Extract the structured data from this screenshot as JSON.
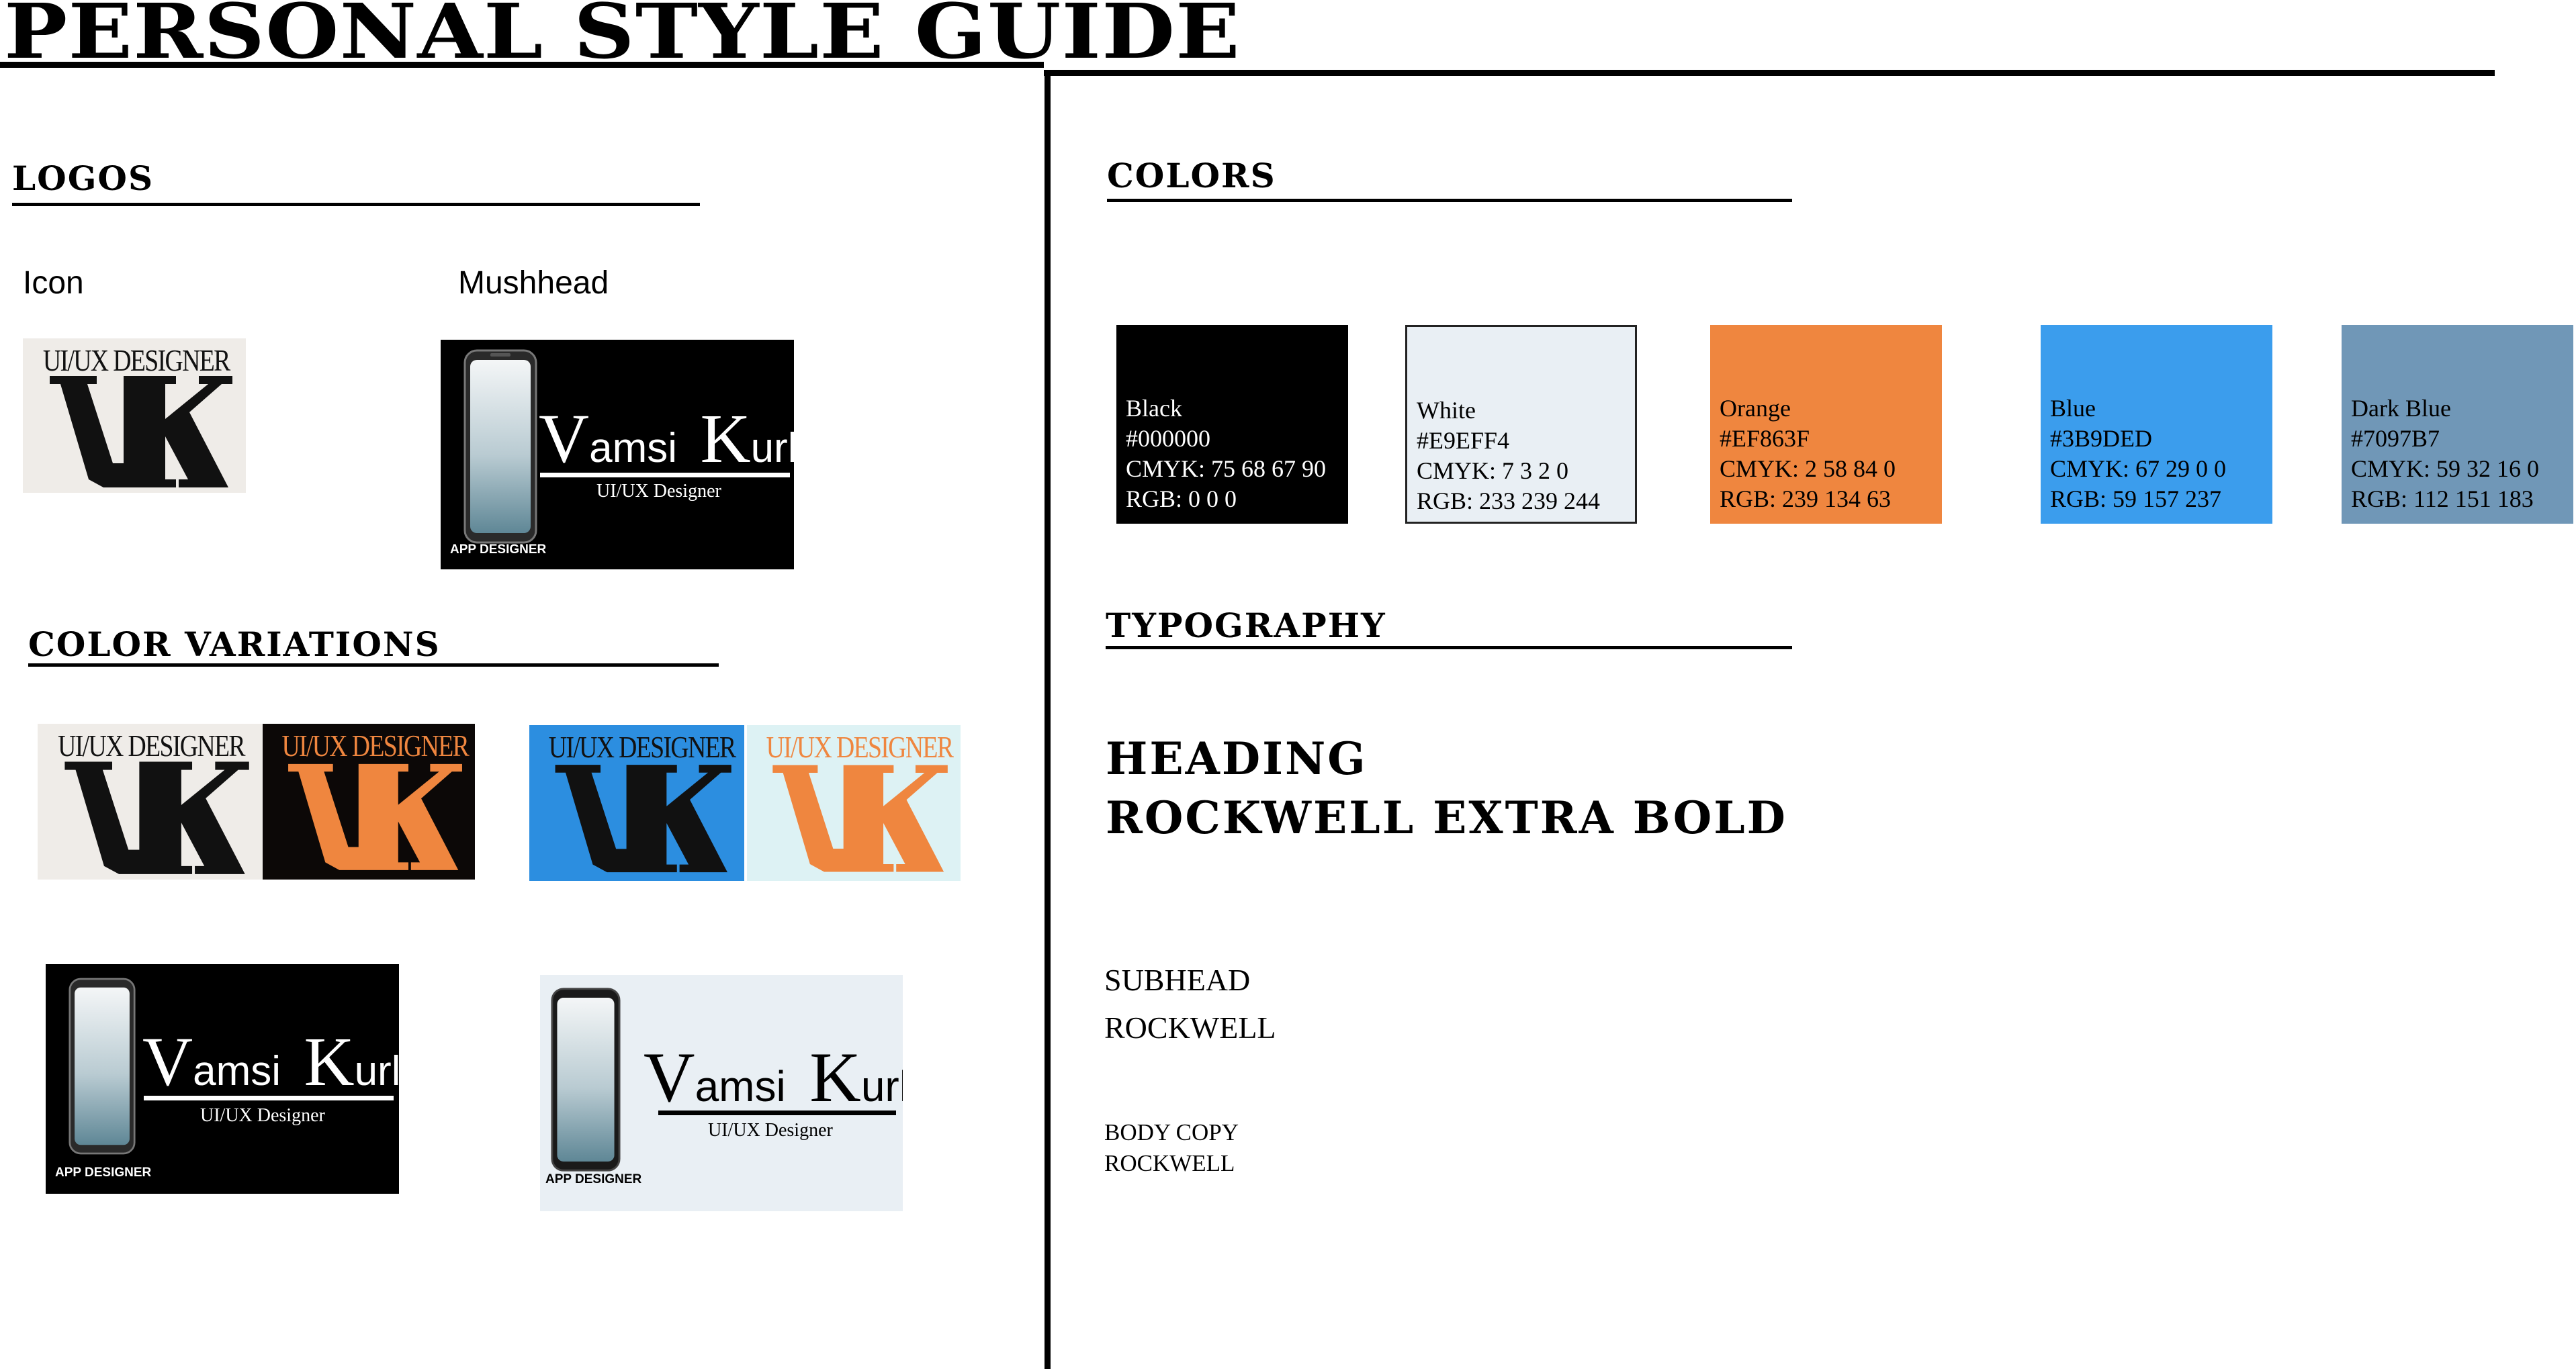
{
  "title": "PERSONAL STYLE GUIDE",
  "sections": {
    "logos": "LOGOS",
    "color_variations": "COLOR VARIATIONS",
    "colors": "COLORS",
    "typography": "TYPOGRAPHY"
  },
  "logos": {
    "icon_label": "Icon",
    "mushhead_label": "Mushhead"
  },
  "logo_text": {
    "caption": "UI/UX DESIGNER",
    "name_first_initial": "V",
    "name_first_rest": "amsi",
    "name_last_initial": "K",
    "name_last_rest": "urli",
    "subtitle": "UI/UX Designer",
    "tag": "APP DESIGNER"
  },
  "swatches": [
    {
      "name": "Black",
      "hex": "#000000",
      "cmyk": "CMYK: 75 68 67 90",
      "rgb": "RGB: 0 0 0",
      "fill": "#000000",
      "text": "#ffffff"
    },
    {
      "name": "White",
      "hex": "#E9EFF4",
      "cmyk": "CMYK: 7 3 2 0",
      "rgb": "RGB: 233 239 244",
      "fill": "#E9EFF4",
      "text": "#000000"
    },
    {
      "name": "Orange",
      "hex": "#EF863F",
      "cmyk": "CMYK: 2 58 84 0",
      "rgb": "RGB: 239 134 63",
      "fill": "#EF863F",
      "text": "#000000"
    },
    {
      "name": "Blue",
      "hex": "#3B9DED",
      "cmyk": "CMYK: 67 29 0 0",
      "rgb": "RGB: 59 157 237",
      "fill": "#3B9DED",
      "text": "#000000"
    },
    {
      "name": "Dark Blue",
      "hex": "#7097B7",
      "cmyk": "CMYK: 59 32 16 0",
      "rgb": "RGB: 112 151 183",
      "fill": "#7097B7",
      "text": "#000000"
    }
  ],
  "typography": {
    "heading_line1": "HEADING",
    "heading_line2": "ROCKWELL EXTRA BOLD",
    "subhead_line1": "SUBHEAD",
    "subhead_line2": "ROCKWELL",
    "body_line1": "BODY COPY",
    "body_line2": "ROCKWELL"
  }
}
